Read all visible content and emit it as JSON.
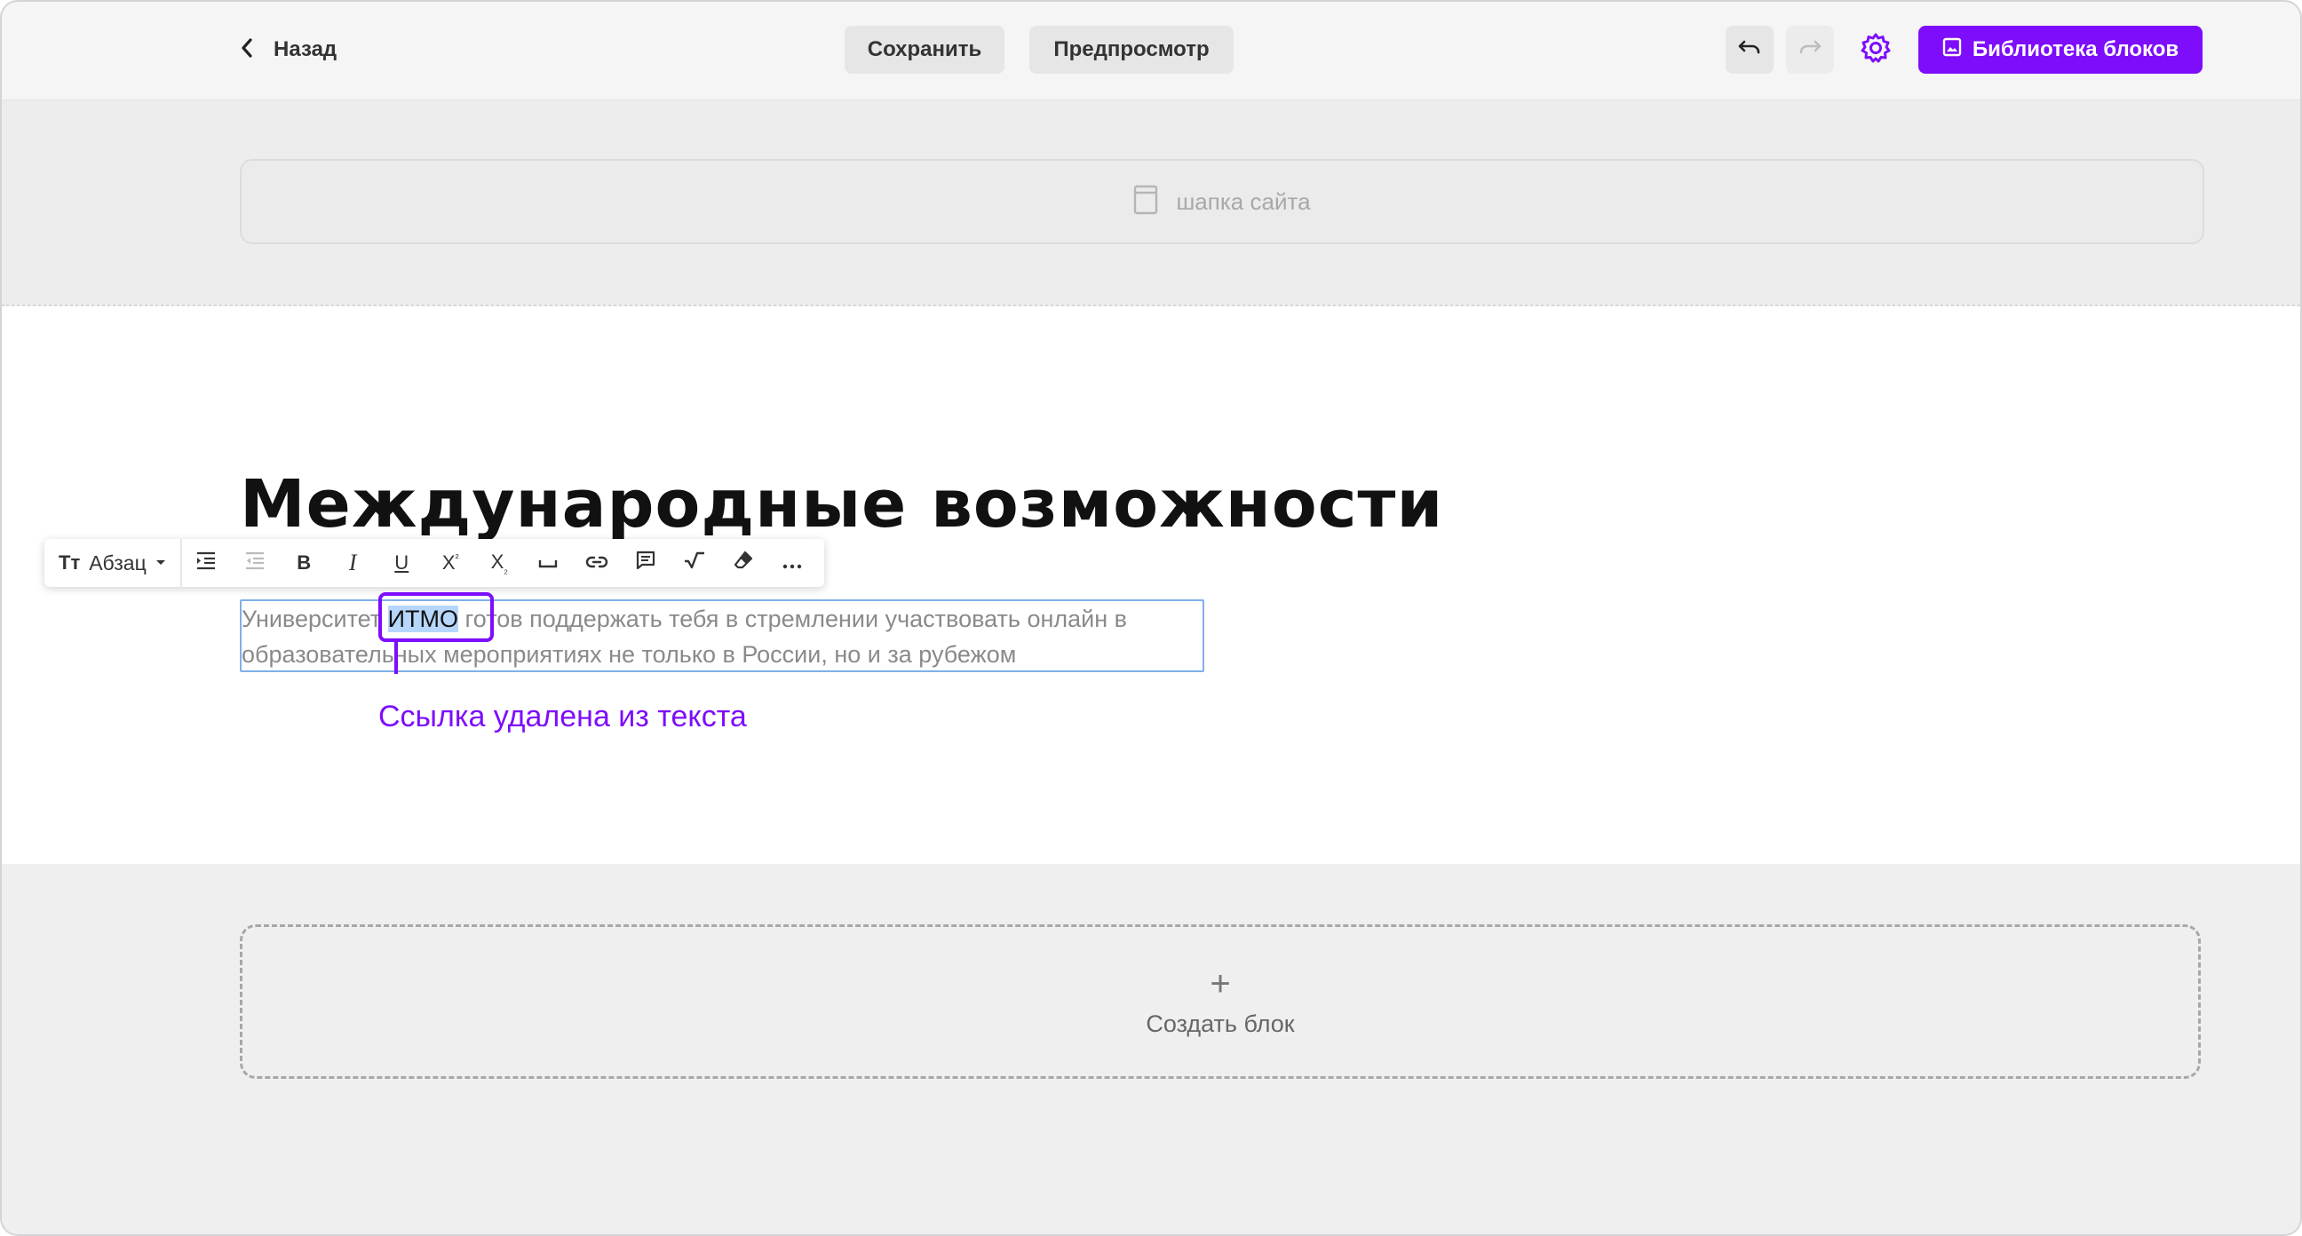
{
  "topbar": {
    "back_label": "Назад",
    "save_label": "Сохранить",
    "preview_label": "Предпросмотр",
    "library_label": "Библиотека блоков",
    "accent_color": "#7d0dfb"
  },
  "header_placeholder": {
    "label": "шапка сайта"
  },
  "content": {
    "title": "Международные возможности",
    "paragraph_line1_before": "Университет ",
    "paragraph_selected": "ИТМО",
    "paragraph_line1_after": " готов поддержать тебя в стремлении участвовать онлайн в",
    "paragraph_line2": "образовательных мероприятиях не только в России, но и за рубежом"
  },
  "toolbar": {
    "format_icon": "Tт",
    "format_label": "Абзац",
    "buttons": [
      "indent-icon",
      "outdent-icon",
      "bold-icon",
      "italic-icon",
      "underline-icon",
      "superscript-icon",
      "subscript-icon",
      "nbsp-icon",
      "link-icon",
      "comment-icon",
      "formula-icon",
      "eraser-icon",
      "more-icon"
    ]
  },
  "annotation": {
    "text": "Ссылка удалена из текста"
  },
  "create_block": {
    "label": "Создать блок"
  }
}
